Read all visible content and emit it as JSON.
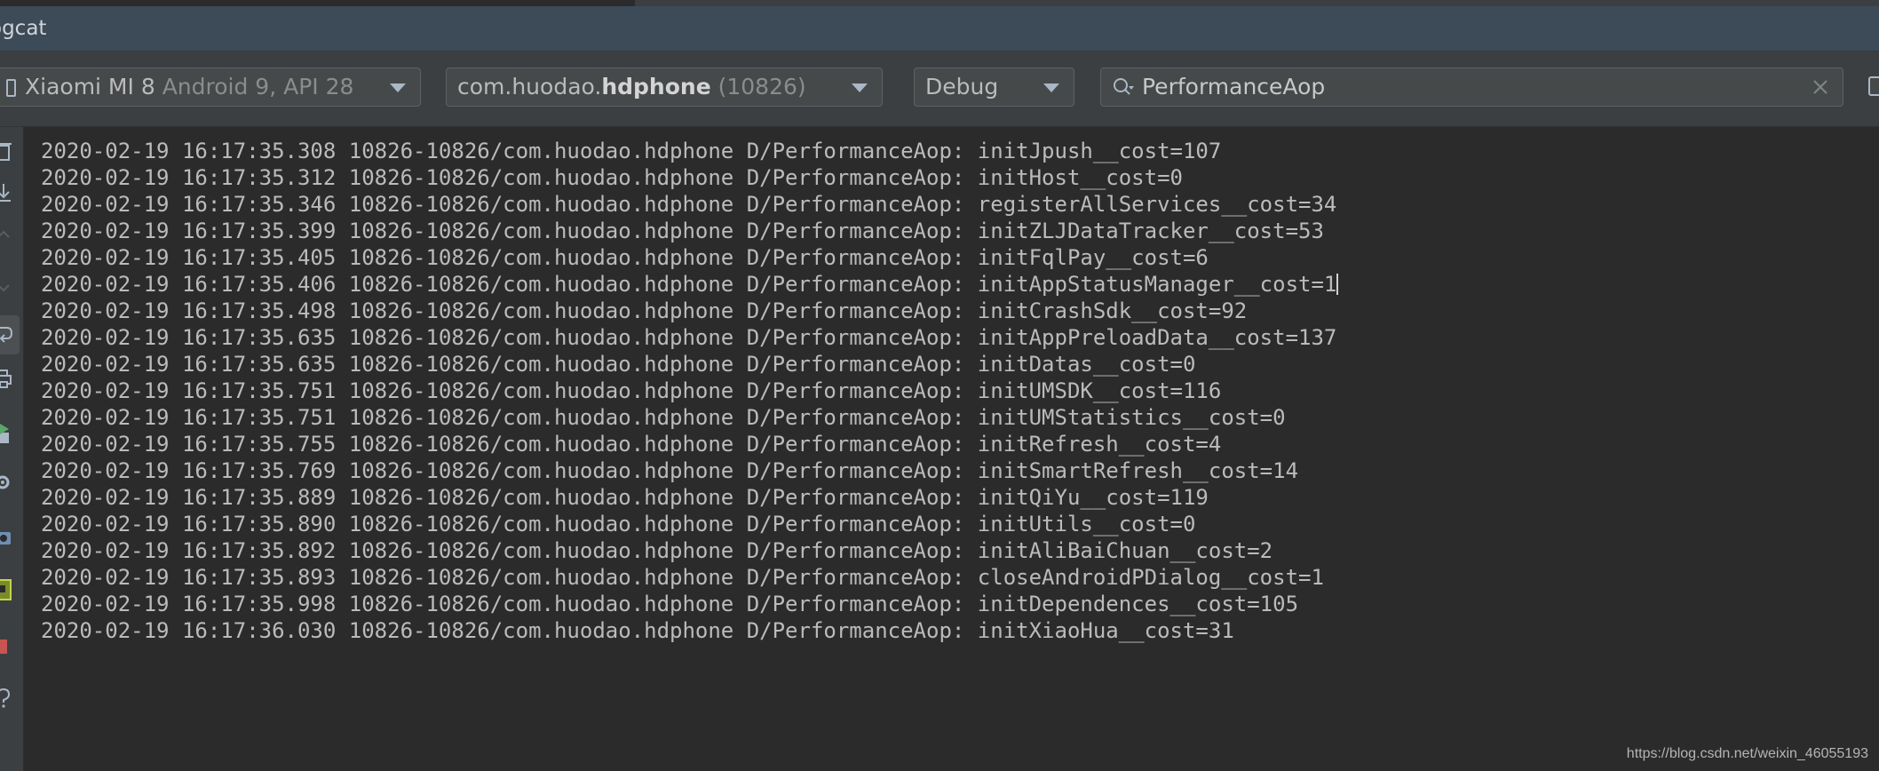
{
  "window": {
    "title": "ogcat"
  },
  "toolbar": {
    "device": {
      "name": "Xiaomi MI 8",
      "detail": "Android 9, API 28"
    },
    "process": {
      "prefix": "com.huodao.",
      "bold": "hdphone",
      "pid": "(10826)"
    },
    "log_level": "Debug",
    "search": {
      "value": "PerformanceAop"
    }
  },
  "log": {
    "lines": [
      "2020-02-19 16:17:35.308 10826-10826/com.huodao.hdphone D/PerformanceAop: initJpush__cost=107",
      "2020-02-19 16:17:35.312 10826-10826/com.huodao.hdphone D/PerformanceAop: initHost__cost=0",
      "2020-02-19 16:17:35.346 10826-10826/com.huodao.hdphone D/PerformanceAop: registerAllServices__cost=34",
      "2020-02-19 16:17:35.399 10826-10826/com.huodao.hdphone D/PerformanceAop: initZLJDataTracker__cost=53",
      "2020-02-19 16:17:35.405 10826-10826/com.huodao.hdphone D/PerformanceAop: initFqlPay__cost=6",
      "2020-02-19 16:17:35.406 10826-10826/com.huodao.hdphone D/PerformanceAop: initAppStatusManager__cost=1",
      "2020-02-19 16:17:35.498 10826-10826/com.huodao.hdphone D/PerformanceAop: initCrashSdk__cost=92",
      "2020-02-19 16:17:35.635 10826-10826/com.huodao.hdphone D/PerformanceAop: initAppPreloadData__cost=137",
      "2020-02-19 16:17:35.635 10826-10826/com.huodao.hdphone D/PerformanceAop: initDatas__cost=0",
      "2020-02-19 16:17:35.751 10826-10826/com.huodao.hdphone D/PerformanceAop: initUMSDK__cost=116",
      "2020-02-19 16:17:35.751 10826-10826/com.huodao.hdphone D/PerformanceAop: initUMStatistics__cost=0",
      "2020-02-19 16:17:35.755 10826-10826/com.huodao.hdphone D/PerformanceAop: initRefresh__cost=4",
      "2020-02-19 16:17:35.769 10826-10826/com.huodao.hdphone D/PerformanceAop: initSmartRefresh__cost=14",
      "2020-02-19 16:17:35.889 10826-10826/com.huodao.hdphone D/PerformanceAop: initQiYu__cost=119",
      "2020-02-19 16:17:35.890 10826-10826/com.huodao.hdphone D/PerformanceAop: initUtils__cost=0",
      "2020-02-19 16:17:35.892 10826-10826/com.huodao.hdphone D/PerformanceAop: initAliBaiChuan__cost=2",
      "2020-02-19 16:17:35.893 10826-10826/com.huodao.hdphone D/PerformanceAop: closeAndroidPDialog__cost=1",
      "2020-02-19 16:17:35.998 10826-10826/com.huodao.hdphone D/PerformanceAop: initDependences__cost=105",
      "2020-02-19 16:17:36.030 10826-10826/com.huodao.hdphone D/PerformanceAop: initXiaoHua__cost=31"
    ],
    "cursor_line": 5
  },
  "watermark": "https://blog.csdn.net/weixin_46055193",
  "colors": {
    "title_bar": "#3d4a58",
    "toolbar": "#3c3f41",
    "editor_bg": "#2b2b2b",
    "text": "#bbbbbb",
    "accent_green": "#59a869",
    "accent_red": "#c75450"
  }
}
